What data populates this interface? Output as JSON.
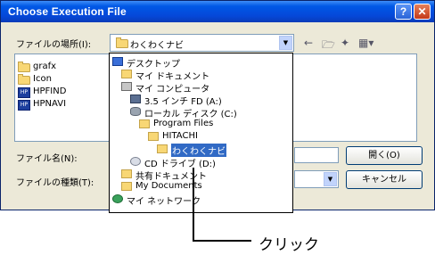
{
  "window": {
    "title": "Choose Execution File",
    "help_glyph": "?",
    "close_glyph": "✕"
  },
  "lookin": {
    "label": "ファイルの場所(I):",
    "value": "わくわくナビ"
  },
  "toolbar_icons": {
    "back": "←",
    "up": "🗁",
    "new_folder": "✦",
    "view_menu": "▦▾"
  },
  "files": [
    {
      "name": "grafx",
      "icon": "folder-icon"
    },
    {
      "name": "Icon",
      "icon": "folder-icon"
    },
    {
      "name": "HPFIND",
      "icon": "app-icon"
    },
    {
      "name": "HPNAVI",
      "icon": "app-icon"
    }
  ],
  "dropdown_items": [
    {
      "label": "デスクトップ",
      "icon": "desktop-icon"
    },
    {
      "label": "マイ ドキュメント",
      "icon": "documents-icon"
    },
    {
      "label": "マイ コンピュータ",
      "icon": "computer-icon"
    },
    {
      "label": "3.5 インチ FD (A:)",
      "icon": "floppy-icon"
    },
    {
      "label": "ローカル ディスク (C:)",
      "icon": "hard-disk-icon"
    },
    {
      "label": "Program Files",
      "icon": "folder-icon"
    },
    {
      "label": "HITACHI",
      "icon": "folder-icon"
    },
    {
      "label": "わくわくナビ",
      "icon": "folder-icon",
      "selected": true
    },
    {
      "label": "CD ドライブ (D:)",
      "icon": "cd-drive-icon"
    },
    {
      "label": "共有ドキュメント",
      "icon": "folder-icon"
    },
    {
      "label": "My Documents",
      "icon": "folder-icon"
    },
    {
      "label": "マイ ネットワーク",
      "icon": "network-icon"
    }
  ],
  "filename": {
    "label": "ファイル名(N):",
    "value": ""
  },
  "filetype": {
    "label": "ファイルの種類(T):",
    "value": ""
  },
  "buttons": {
    "open": "開く(O)",
    "cancel": "キャンセル"
  },
  "annotation": {
    "text": "クリック"
  },
  "colors": {
    "titlebar": "#0548d9",
    "selection": "#316ac5",
    "dialog_bg": "#ece9d8"
  }
}
